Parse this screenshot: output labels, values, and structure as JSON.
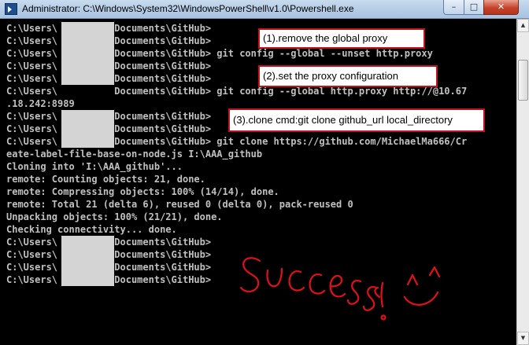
{
  "window": {
    "title": "Administrator: C:\\Windows\\System32\\WindowsPowerShell\\v1.0\\Powershell.exe",
    "minimize_glyph": "–",
    "maximize_glyph": "□",
    "close_glyph": "✕"
  },
  "console": {
    "lines": [
      "C:\\Users\\          Documents\\GitHub>",
      "C:\\Users\\          Documents\\GitHub>",
      "C:\\Users\\          Documents\\GitHub> git config --global --unset http.proxy",
      "C:\\Users\\          Documents\\GitHub>",
      "C:\\Users\\          Documents\\GitHub>",
      "C:\\Users\\          Documents\\GitHub> git config --global http.proxy http://@10.67",
      ".18.242:8989",
      "C:\\Users\\          Documents\\GitHub>",
      "C:\\Users\\          Documents\\GitHub>",
      "C:\\Users\\          Documents\\GitHub> git clone https://github.com/MichaelMa666/Cr",
      "eate-label-file-base-on-node.js I:\\AAA_github",
      "Cloning into 'I:\\AAA_github'...",
      "remote: Counting objects: 21, done.",
      "remote: Compressing objects: 100% (14/14), done.",
      "remote: Total 21 (delta 6), reused 0 (delta 0), pack-reused 0",
      "Unpacking objects: 100% (21/21), done.",
      "Checking connectivity... done.",
      "C:\\Users\\          Documents\\GitHub>",
      "C:\\Users\\          Documents\\GitHub>",
      "C:\\Users\\          Documents\\GitHub>",
      "C:\\Users\\          Documents\\GitHub>"
    ]
  },
  "annotations": {
    "note1": "(1).remove the global proxy",
    "note2": "(2).set the proxy configuration",
    "note3": "(3).clone cmd:git clone github_url local_directory",
    "handwriting": "Success! ^_^"
  },
  "colors": {
    "console_bg": "#000000",
    "console_text": "#c0c0c0",
    "annotation_border": "#c1121c",
    "handwriting": "#e0101a"
  }
}
